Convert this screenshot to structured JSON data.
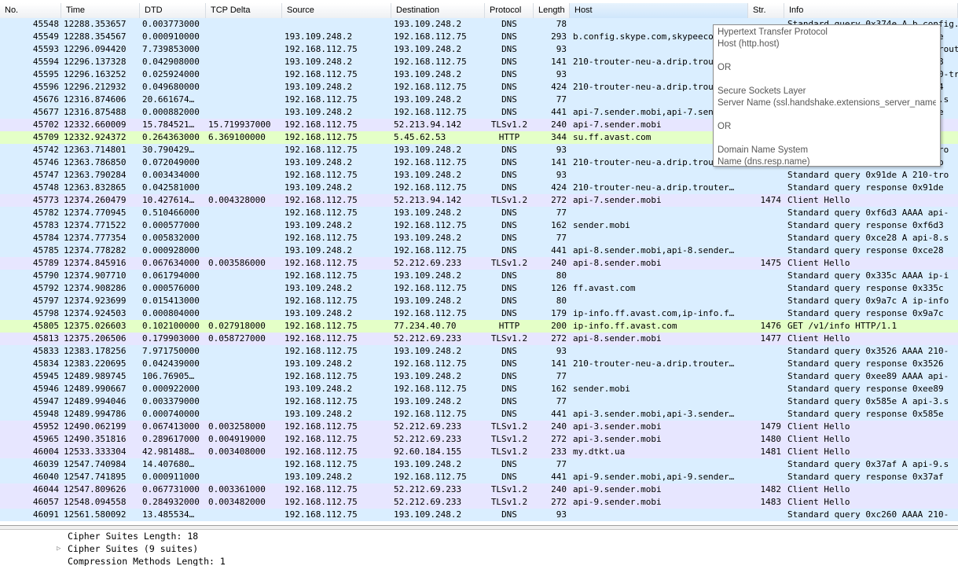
{
  "columns": [
    "No.",
    "Time",
    "DTD",
    "TCP Delta",
    "Source",
    "Destination",
    "Protocol",
    "Length",
    "Host",
    "Str.",
    "Info"
  ],
  "colors": {
    "dns": "#daeeff",
    "tls": "#e7e6ff",
    "http": "#e4ffc7"
  },
  "rows": [
    {
      "no": "45548",
      "time": "12288.353657",
      "dtd": "0.003773000",
      "tcp": "",
      "src": "",
      "dst": "193.109.248.2",
      "proto": "DNS",
      "len": "78",
      "host": "",
      "str": "",
      "info": "Standard query 0x374e A b.config.skype.com",
      "kind": "dns"
    },
    {
      "no": "45549",
      "time": "12288.354567",
      "dtd": "0.000910000",
      "tcp": "",
      "src": "193.109.248.2",
      "dst": "192.168.112.75",
      "proto": "DNS",
      "len": "293",
      "host": "b.config.skype.com,skypeeco.trafficmanager.net",
      "str": "",
      "info": "Standard query response 0x374e",
      "kind": "dns"
    },
    {
      "no": "45593",
      "time": "12296.094420",
      "dtd": "7.739853000",
      "tcp": "",
      "src": "192.168.112.75",
      "dst": "193.109.248.2",
      "proto": "DNS",
      "len": "93",
      "host": "",
      "str": "",
      "info": "Standard query 0x6c58 A 210-trouter",
      "kind": "dns"
    },
    {
      "no": "45594",
      "time": "12296.137328",
      "dtd": "0.042908000",
      "tcp": "",
      "src": "193.109.248.2",
      "dst": "192.168.112.75",
      "proto": "DNS",
      "len": "141",
      "host": "210-trouter-neu-a.drip.trouter.io",
      "str": "",
      "info": "Standard query response 0x6c58",
      "kind": "dns"
    },
    {
      "no": "45595",
      "time": "12296.163252",
      "dtd": "0.025924000",
      "tcp": "",
      "src": "192.168.112.75",
      "dst": "193.109.248.2",
      "proto": "DNS",
      "len": "93",
      "host": "",
      "str": "",
      "info": "Standard query 0x8b64 AAAA 210-tro",
      "kind": "dns"
    },
    {
      "no": "45596",
      "time": "12296.212932",
      "dtd": "0.049680000",
      "tcp": "",
      "src": "193.109.248.2",
      "dst": "192.168.112.75",
      "proto": "DNS",
      "len": "424",
      "host": "210-trouter-neu-a.drip.trouter.io",
      "str": "",
      "info": "Standard query response 0x8b64",
      "kind": "dns"
    },
    {
      "no": "45676",
      "time": "12316.874606",
      "dtd": "20.661674…",
      "tcp": "",
      "src": "192.168.112.75",
      "dst": "193.109.248.2",
      "proto": "DNS",
      "len": "77",
      "host": "",
      "str": "",
      "info": "Standard query 0x41fe A api-7.s",
      "kind": "dns"
    },
    {
      "no": "45677",
      "time": "12316.875488",
      "dtd": "0.000882000",
      "tcp": "",
      "src": "193.109.248.2",
      "dst": "192.168.112.75",
      "proto": "DNS",
      "len": "441",
      "host": "api-7.sender.mobi,api-7.sender.mobi",
      "str": "",
      "info": "Standard query response 0x41fe",
      "kind": "dns"
    },
    {
      "no": "45702",
      "time": "12332.660009",
      "dtd": "15.784521…",
      "tcp": "15.719937000",
      "src": "192.168.112.75",
      "dst": "52.213.94.142",
      "proto": "TLSv1.2",
      "len": "240",
      "host": "api-7.sender.mobi",
      "str": "",
      "info": "Client Hello",
      "kind": "tls"
    },
    {
      "no": "45709",
      "time": "12332.924372",
      "dtd": "0.264363000",
      "tcp": "6.369100000",
      "src": "192.168.112.75",
      "dst": "5.45.62.53",
      "proto": "HTTP",
      "len": "344",
      "host": "su.ff.avast.com",
      "str": "",
      "info": "POST /R/A3oKIGRjZjQ4",
      "kind": "http"
    },
    {
      "no": "45742",
      "time": "12363.714801",
      "dtd": "30.790429…",
      "tcp": "",
      "src": "192.168.112.75",
      "dst": "193.109.248.2",
      "proto": "DNS",
      "len": "93",
      "host": "",
      "str": "",
      "info": "Standard query 0x8c4b A 210-tro",
      "kind": "dns"
    },
    {
      "no": "45746",
      "time": "12363.786850",
      "dtd": "0.072049000",
      "tcp": "",
      "src": "193.109.248.2",
      "dst": "192.168.112.75",
      "proto": "DNS",
      "len": "141",
      "host": "210-trouter-neu-a.drip.trouter.io",
      "str": "",
      "info": "Standard query response 0x8c4b",
      "kind": "dns"
    },
    {
      "no": "45747",
      "time": "12363.790284",
      "dtd": "0.003434000",
      "tcp": "",
      "src": "192.168.112.75",
      "dst": "193.109.248.2",
      "proto": "DNS",
      "len": "93",
      "host": "",
      "str": "",
      "info": "Standard query 0x91de A 210-tro",
      "kind": "dns"
    },
    {
      "no": "45748",
      "time": "12363.832865",
      "dtd": "0.042581000",
      "tcp": "",
      "src": "193.109.248.2",
      "dst": "192.168.112.75",
      "proto": "DNS",
      "len": "424",
      "host": "210-trouter-neu-a.drip.trouter…",
      "str": "",
      "info": "Standard query response 0x91de",
      "kind": "dns"
    },
    {
      "no": "45773",
      "time": "12374.260479",
      "dtd": "10.427614…",
      "tcp": "0.004328000",
      "src": "192.168.112.75",
      "dst": "52.213.94.142",
      "proto": "TLSv1.2",
      "len": "272",
      "host": "api-7.sender.mobi",
      "str": "1474",
      "info": "Client Hello",
      "kind": "tls"
    },
    {
      "no": "45782",
      "time": "12374.770945",
      "dtd": "0.510466000",
      "tcp": "",
      "src": "192.168.112.75",
      "dst": "193.109.248.2",
      "proto": "DNS",
      "len": "77",
      "host": "",
      "str": "",
      "info": "Standard query 0xf6d3 AAAA api-",
      "kind": "dns"
    },
    {
      "no": "45783",
      "time": "12374.771522",
      "dtd": "0.000577000",
      "tcp": "",
      "src": "193.109.248.2",
      "dst": "192.168.112.75",
      "proto": "DNS",
      "len": "162",
      "host": "sender.mobi",
      "str": "",
      "info": "Standard query response 0xf6d3",
      "kind": "dns"
    },
    {
      "no": "45784",
      "time": "12374.777354",
      "dtd": "0.005832000",
      "tcp": "",
      "src": "192.168.112.75",
      "dst": "193.109.248.2",
      "proto": "DNS",
      "len": "77",
      "host": "",
      "str": "",
      "info": "Standard query 0xce28 A api-8.s",
      "kind": "dns"
    },
    {
      "no": "45785",
      "time": "12374.778282",
      "dtd": "0.000928000",
      "tcp": "",
      "src": "193.109.248.2",
      "dst": "192.168.112.75",
      "proto": "DNS",
      "len": "441",
      "host": "api-8.sender.mobi,api-8.sender…",
      "str": "",
      "info": "Standard query response 0xce28",
      "kind": "dns"
    },
    {
      "no": "45789",
      "time": "12374.845916",
      "dtd": "0.067634000",
      "tcp": "0.003586000",
      "src": "192.168.112.75",
      "dst": "52.212.69.233",
      "proto": "TLSv1.2",
      "len": "240",
      "host": "api-8.sender.mobi",
      "str": "1475",
      "info": "Client Hello",
      "kind": "tls"
    },
    {
      "no": "45790",
      "time": "12374.907710",
      "dtd": "0.061794000",
      "tcp": "",
      "src": "192.168.112.75",
      "dst": "193.109.248.2",
      "proto": "DNS",
      "len": "80",
      "host": "",
      "str": "",
      "info": "Standard query 0x335c AAAA ip-i",
      "kind": "dns"
    },
    {
      "no": "45792",
      "time": "12374.908286",
      "dtd": "0.000576000",
      "tcp": "",
      "src": "193.109.248.2",
      "dst": "192.168.112.75",
      "proto": "DNS",
      "len": "126",
      "host": "ff.avast.com",
      "str": "",
      "info": "Standard query response 0x335c",
      "kind": "dns"
    },
    {
      "no": "45797",
      "time": "12374.923699",
      "dtd": "0.015413000",
      "tcp": "",
      "src": "192.168.112.75",
      "dst": "193.109.248.2",
      "proto": "DNS",
      "len": "80",
      "host": "",
      "str": "",
      "info": "Standard query 0x9a7c A ip-info",
      "kind": "dns"
    },
    {
      "no": "45798",
      "time": "12374.924503",
      "dtd": "0.000804000",
      "tcp": "",
      "src": "193.109.248.2",
      "dst": "192.168.112.75",
      "proto": "DNS",
      "len": "179",
      "host": "ip-info.ff.avast.com,ip-info.f…",
      "str": "",
      "info": "Standard query response 0x9a7c",
      "kind": "dns"
    },
    {
      "no": "45805",
      "time": "12375.026603",
      "dtd": "0.102100000",
      "tcp": "0.027918000",
      "src": "192.168.112.75",
      "dst": "77.234.40.70",
      "proto": "HTTP",
      "len": "200",
      "host": "ip-info.ff.avast.com",
      "str": "1476",
      "info": "GET /v1/info HTTP/1.1",
      "kind": "http"
    },
    {
      "no": "45813",
      "time": "12375.206506",
      "dtd": "0.179903000",
      "tcp": "0.058727000",
      "src": "192.168.112.75",
      "dst": "52.212.69.233",
      "proto": "TLSv1.2",
      "len": "272",
      "host": "api-8.sender.mobi",
      "str": "1477",
      "info": "Client Hello",
      "kind": "tls"
    },
    {
      "no": "45833",
      "time": "12383.178256",
      "dtd": "7.971750000",
      "tcp": "",
      "src": "192.168.112.75",
      "dst": "193.109.248.2",
      "proto": "DNS",
      "len": "93",
      "host": "",
      "str": "",
      "info": "Standard query 0x3526 AAAA 210-",
      "kind": "dns"
    },
    {
      "no": "45834",
      "time": "12383.220695",
      "dtd": "0.042439000",
      "tcp": "",
      "src": "193.109.248.2",
      "dst": "192.168.112.75",
      "proto": "DNS",
      "len": "141",
      "host": "210-trouter-neu-a.drip.trouter…",
      "str": "",
      "info": "Standard query response 0x3526",
      "kind": "dns"
    },
    {
      "no": "45945",
      "time": "12489.989745",
      "dtd": "106.76905…",
      "tcp": "",
      "src": "192.168.112.75",
      "dst": "193.109.248.2",
      "proto": "DNS",
      "len": "77",
      "host": "",
      "str": "",
      "info": "Standard query 0xee89 AAAA api-",
      "kind": "dns"
    },
    {
      "no": "45946",
      "time": "12489.990667",
      "dtd": "0.000922000",
      "tcp": "",
      "src": "193.109.248.2",
      "dst": "192.168.112.75",
      "proto": "DNS",
      "len": "162",
      "host": "sender.mobi",
      "str": "",
      "info": "Standard query response 0xee89",
      "kind": "dns"
    },
    {
      "no": "45947",
      "time": "12489.994046",
      "dtd": "0.003379000",
      "tcp": "",
      "src": "192.168.112.75",
      "dst": "193.109.248.2",
      "proto": "DNS",
      "len": "77",
      "host": "",
      "str": "",
      "info": "Standard query 0x585e A api-3.s",
      "kind": "dns"
    },
    {
      "no": "45948",
      "time": "12489.994786",
      "dtd": "0.000740000",
      "tcp": "",
      "src": "193.109.248.2",
      "dst": "192.168.112.75",
      "proto": "DNS",
      "len": "441",
      "host": "api-3.sender.mobi,api-3.sender…",
      "str": "",
      "info": "Standard query response 0x585e",
      "kind": "dns"
    },
    {
      "no": "45952",
      "time": "12490.062199",
      "dtd": "0.067413000",
      "tcp": "0.003258000",
      "src": "192.168.112.75",
      "dst": "52.212.69.233",
      "proto": "TLSv1.2",
      "len": "240",
      "host": "api-3.sender.mobi",
      "str": "1479",
      "info": "Client Hello",
      "kind": "tls"
    },
    {
      "no": "45965",
      "time": "12490.351816",
      "dtd": "0.289617000",
      "tcp": "0.004919000",
      "src": "192.168.112.75",
      "dst": "52.212.69.233",
      "proto": "TLSv1.2",
      "len": "272",
      "host": "api-3.sender.mobi",
      "str": "1480",
      "info": "Client Hello",
      "kind": "tls"
    },
    {
      "no": "46004",
      "time": "12533.333304",
      "dtd": "42.981488…",
      "tcp": "0.003408000",
      "src": "192.168.112.75",
      "dst": "92.60.184.155",
      "proto": "TLSv1.2",
      "len": "233",
      "host": "my.dtkt.ua",
      "str": "1481",
      "info": "Client Hello",
      "kind": "tls"
    },
    {
      "no": "46039",
      "time": "12547.740984",
      "dtd": "14.407680…",
      "tcp": "",
      "src": "192.168.112.75",
      "dst": "193.109.248.2",
      "proto": "DNS",
      "len": "77",
      "host": "",
      "str": "",
      "info": "Standard query 0x37af A api-9.s",
      "kind": "dns"
    },
    {
      "no": "46040",
      "time": "12547.741895",
      "dtd": "0.000911000",
      "tcp": "",
      "src": "193.109.248.2",
      "dst": "192.168.112.75",
      "proto": "DNS",
      "len": "441",
      "host": "api-9.sender.mobi,api-9.sender…",
      "str": "",
      "info": "Standard query response 0x37af",
      "kind": "dns"
    },
    {
      "no": "46044",
      "time": "12547.809626",
      "dtd": "0.067731000",
      "tcp": "0.003361000",
      "src": "192.168.112.75",
      "dst": "52.212.69.233",
      "proto": "TLSv1.2",
      "len": "240",
      "host": "api-9.sender.mobi",
      "str": "1482",
      "info": "Client Hello",
      "kind": "tls"
    },
    {
      "no": "46057",
      "time": "12548.094558",
      "dtd": "0.284932000",
      "tcp": "0.003482000",
      "src": "192.168.112.75",
      "dst": "52.212.69.233",
      "proto": "TLSv1.2",
      "len": "272",
      "host": "api-9.sender.mobi",
      "str": "1483",
      "info": "Client Hello",
      "kind": "tls"
    },
    {
      "no": "46091",
      "time": "12561.580092",
      "dtd": "13.485534…",
      "tcp": "",
      "src": "192.168.112.75",
      "dst": "193.109.248.2",
      "proto": "DNS",
      "len": "93",
      "host": "",
      "str": "",
      "info": "Standard query 0xc260 AAAA 210-",
      "kind": "dns"
    }
  ],
  "tooltip": {
    "lines": [
      "Hypertext Transfer Protocol",
      "Host (http.host)",
      "",
      "OR",
      "",
      "Secure Sockets Layer",
      "Server Name (ssl.handshake.extensions_server_name)",
      "",
      "OR",
      "",
      "Domain Name System",
      "Name (dns.resp.name)"
    ]
  },
  "details": [
    {
      "text": "Cipher Suites Length: 18",
      "expandable": false
    },
    {
      "text": "Cipher Suites (9 suites)",
      "expandable": true
    },
    {
      "text": "Compression Methods Length: 1",
      "expandable": false
    }
  ]
}
